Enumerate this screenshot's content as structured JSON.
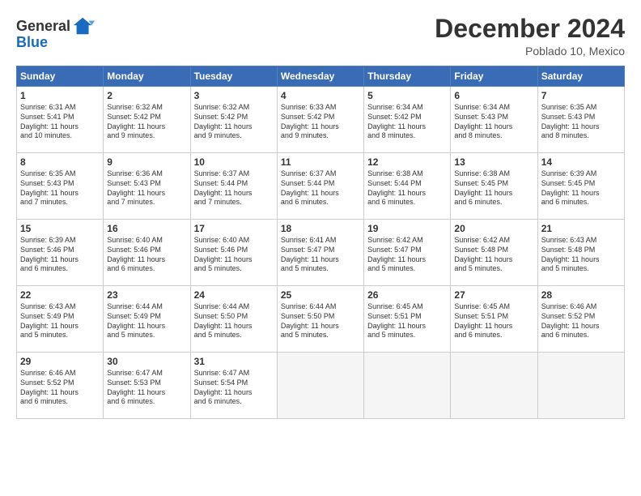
{
  "logo": {
    "general": "General",
    "blue": "Blue"
  },
  "header": {
    "month": "December 2024",
    "location": "Poblado 10, Mexico"
  },
  "weekdays": [
    "Sunday",
    "Monday",
    "Tuesday",
    "Wednesday",
    "Thursday",
    "Friday",
    "Saturday"
  ],
  "weeks": [
    [
      {
        "day": "1",
        "info": "Sunrise: 6:31 AM\nSunset: 5:41 PM\nDaylight: 11 hours\nand 10 minutes."
      },
      {
        "day": "2",
        "info": "Sunrise: 6:32 AM\nSunset: 5:42 PM\nDaylight: 11 hours\nand 9 minutes."
      },
      {
        "day": "3",
        "info": "Sunrise: 6:32 AM\nSunset: 5:42 PM\nDaylight: 11 hours\nand 9 minutes."
      },
      {
        "day": "4",
        "info": "Sunrise: 6:33 AM\nSunset: 5:42 PM\nDaylight: 11 hours\nand 9 minutes."
      },
      {
        "day": "5",
        "info": "Sunrise: 6:34 AM\nSunset: 5:42 PM\nDaylight: 11 hours\nand 8 minutes."
      },
      {
        "day": "6",
        "info": "Sunrise: 6:34 AM\nSunset: 5:43 PM\nDaylight: 11 hours\nand 8 minutes."
      },
      {
        "day": "7",
        "info": "Sunrise: 6:35 AM\nSunset: 5:43 PM\nDaylight: 11 hours\nand 8 minutes."
      }
    ],
    [
      {
        "day": "8",
        "info": "Sunrise: 6:35 AM\nSunset: 5:43 PM\nDaylight: 11 hours\nand 7 minutes."
      },
      {
        "day": "9",
        "info": "Sunrise: 6:36 AM\nSunset: 5:43 PM\nDaylight: 11 hours\nand 7 minutes."
      },
      {
        "day": "10",
        "info": "Sunrise: 6:37 AM\nSunset: 5:44 PM\nDaylight: 11 hours\nand 7 minutes."
      },
      {
        "day": "11",
        "info": "Sunrise: 6:37 AM\nSunset: 5:44 PM\nDaylight: 11 hours\nand 6 minutes."
      },
      {
        "day": "12",
        "info": "Sunrise: 6:38 AM\nSunset: 5:44 PM\nDaylight: 11 hours\nand 6 minutes."
      },
      {
        "day": "13",
        "info": "Sunrise: 6:38 AM\nSunset: 5:45 PM\nDaylight: 11 hours\nand 6 minutes."
      },
      {
        "day": "14",
        "info": "Sunrise: 6:39 AM\nSunset: 5:45 PM\nDaylight: 11 hours\nand 6 minutes."
      }
    ],
    [
      {
        "day": "15",
        "info": "Sunrise: 6:39 AM\nSunset: 5:46 PM\nDaylight: 11 hours\nand 6 minutes."
      },
      {
        "day": "16",
        "info": "Sunrise: 6:40 AM\nSunset: 5:46 PM\nDaylight: 11 hours\nand 6 minutes."
      },
      {
        "day": "17",
        "info": "Sunrise: 6:40 AM\nSunset: 5:46 PM\nDaylight: 11 hours\nand 5 minutes."
      },
      {
        "day": "18",
        "info": "Sunrise: 6:41 AM\nSunset: 5:47 PM\nDaylight: 11 hours\nand 5 minutes."
      },
      {
        "day": "19",
        "info": "Sunrise: 6:42 AM\nSunset: 5:47 PM\nDaylight: 11 hours\nand 5 minutes."
      },
      {
        "day": "20",
        "info": "Sunrise: 6:42 AM\nSunset: 5:48 PM\nDaylight: 11 hours\nand 5 minutes."
      },
      {
        "day": "21",
        "info": "Sunrise: 6:43 AM\nSunset: 5:48 PM\nDaylight: 11 hours\nand 5 minutes."
      }
    ],
    [
      {
        "day": "22",
        "info": "Sunrise: 6:43 AM\nSunset: 5:49 PM\nDaylight: 11 hours\nand 5 minutes."
      },
      {
        "day": "23",
        "info": "Sunrise: 6:44 AM\nSunset: 5:49 PM\nDaylight: 11 hours\nand 5 minutes."
      },
      {
        "day": "24",
        "info": "Sunrise: 6:44 AM\nSunset: 5:50 PM\nDaylight: 11 hours\nand 5 minutes."
      },
      {
        "day": "25",
        "info": "Sunrise: 6:44 AM\nSunset: 5:50 PM\nDaylight: 11 hours\nand 5 minutes."
      },
      {
        "day": "26",
        "info": "Sunrise: 6:45 AM\nSunset: 5:51 PM\nDaylight: 11 hours\nand 5 minutes."
      },
      {
        "day": "27",
        "info": "Sunrise: 6:45 AM\nSunset: 5:51 PM\nDaylight: 11 hours\nand 6 minutes."
      },
      {
        "day": "28",
        "info": "Sunrise: 6:46 AM\nSunset: 5:52 PM\nDaylight: 11 hours\nand 6 minutes."
      }
    ],
    [
      {
        "day": "29",
        "info": "Sunrise: 6:46 AM\nSunset: 5:52 PM\nDaylight: 11 hours\nand 6 minutes."
      },
      {
        "day": "30",
        "info": "Sunrise: 6:47 AM\nSunset: 5:53 PM\nDaylight: 11 hours\nand 6 minutes."
      },
      {
        "day": "31",
        "info": "Sunrise: 6:47 AM\nSunset: 5:54 PM\nDaylight: 11 hours\nand 6 minutes."
      },
      {
        "day": "",
        "info": ""
      },
      {
        "day": "",
        "info": ""
      },
      {
        "day": "",
        "info": ""
      },
      {
        "day": "",
        "info": ""
      }
    ]
  ]
}
